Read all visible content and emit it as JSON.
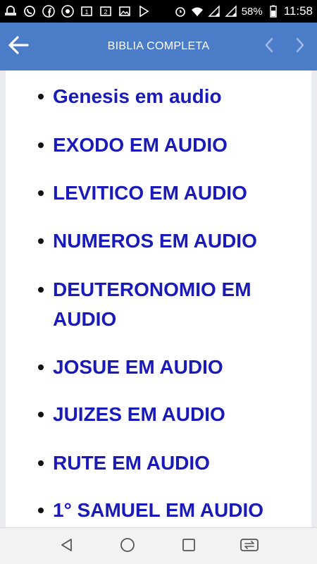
{
  "status_bar": {
    "left_icons": [
      "notification-icon",
      "whatsapp-icon",
      "facebook-icon",
      "chrome-icon",
      "sim-1-icon",
      "sim-2-icon",
      "gallery-icon",
      "play-store-icon"
    ],
    "right_icons": [
      "alarm-icon",
      "wifi-icon",
      "signal-1-icon",
      "signal-2-icon",
      "battery-icon"
    ],
    "battery": "58%",
    "time": "11:58"
  },
  "app_bar": {
    "title": "BIBLIA COMPLETA",
    "back_icon": "arrow-left-icon",
    "prev_icon": "chevron-left-icon",
    "next_icon": "chevron-right-icon",
    "color": "#4a7cc8"
  },
  "books": [
    {
      "label": "Genesis em audio"
    },
    {
      "label": "EXODO EM AUDIO"
    },
    {
      "label": "LEVITICO EM AUDIO"
    },
    {
      "label": "NUMEROS EM AUDIO"
    },
    {
      "label": "DEUTERONOMIO EM AUDIO"
    },
    {
      "label": "JOSUE EM AUDIO"
    },
    {
      "label": "JUIZES EM AUDIO"
    },
    {
      "label": "RUTE EM AUDIO"
    },
    {
      "label": "1° SAMUEL EM AUDIO"
    }
  ],
  "link_color": "#1a1ab8",
  "nav_bar": {
    "buttons": [
      "back-triangle-icon",
      "home-circle-icon",
      "recents-square-icon",
      "switch-sim-icon"
    ]
  }
}
